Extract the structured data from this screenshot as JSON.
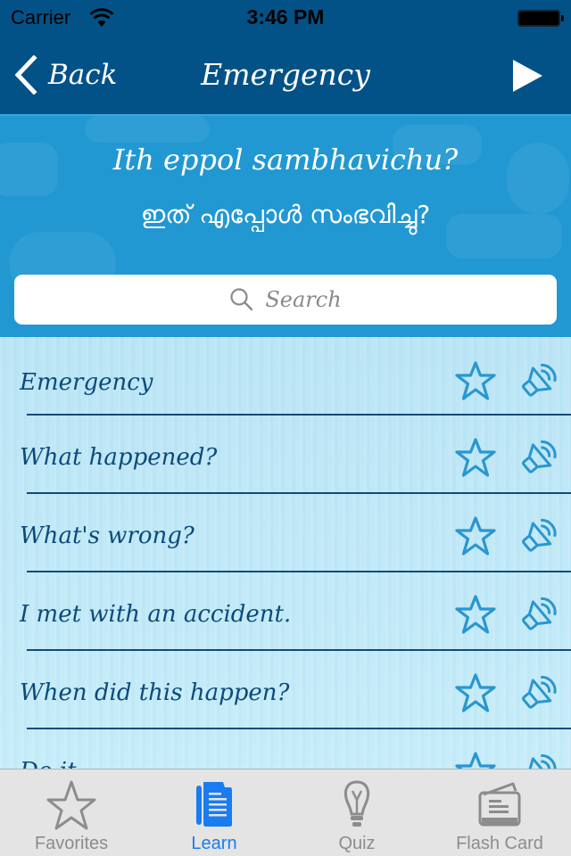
{
  "status_bar": {
    "carrier": "Carrier",
    "time": "3:46 PM",
    "battery_level": 1.0
  },
  "nav": {
    "back_label": "Back",
    "title": "Emergency",
    "play_icon": "play-icon"
  },
  "header": {
    "phrase_romanized": "Ith eppol sambhavichu?",
    "phrase_native": "ഇത് എപ്പോൾ സംഭവിച്ചു?"
  },
  "search": {
    "placeholder": "Search",
    "value": ""
  },
  "list": {
    "items": [
      {
        "text": "Emergency",
        "favorite": false
      },
      {
        "text": "What happened?",
        "favorite": false
      },
      {
        "text": "What's wrong?",
        "favorite": false
      },
      {
        "text": "I met with an accident.",
        "favorite": false
      },
      {
        "text": "When did this happen?",
        "favorite": false
      },
      {
        "text": "Do it...",
        "favorite": false
      }
    ]
  },
  "tabbar": {
    "tabs": [
      {
        "label": "Favorites",
        "icon": "star-icon",
        "active": false
      },
      {
        "label": "Learn",
        "icon": "document-icon",
        "active": true
      },
      {
        "label": "Quiz",
        "icon": "lightbulb-icon",
        "active": false
      },
      {
        "label": "Flash Card",
        "icon": "flash-card-icon",
        "active": false
      }
    ]
  },
  "colors": {
    "nav_bg": "#035287",
    "header_bg": "#2198d2",
    "list_text": "#0c4a7a",
    "icon_accent": "#2a96cf",
    "tab_active": "#1a7cf0",
    "tab_inactive": "#8c8c8c"
  }
}
